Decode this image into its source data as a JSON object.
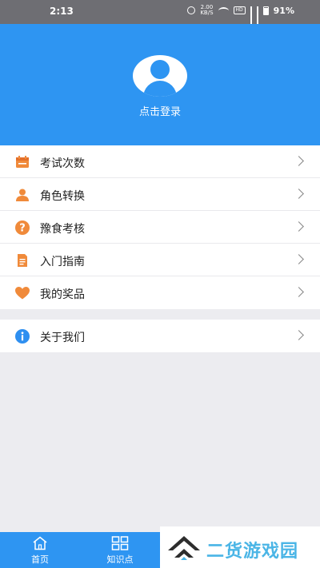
{
  "status_bar": {
    "time": "2:13",
    "net_speed": "2.00",
    "net_unit": "KB/S",
    "hd_badge": "HD",
    "battery_percent": "91%"
  },
  "header": {
    "login_text": "点击登录",
    "accent_color": "#2e95f2"
  },
  "menu": {
    "items": [
      {
        "label": "考试次数",
        "icon": "calendar-icon"
      },
      {
        "label": "角色转换",
        "icon": "user-icon"
      },
      {
        "label": "豫食考核",
        "icon": "question-circle-icon"
      },
      {
        "label": "入门指南",
        "icon": "document-icon"
      },
      {
        "label": "我的奖品",
        "icon": "heart-icon"
      }
    ],
    "about": {
      "label": "关于我们",
      "icon": "info-circle-icon"
    }
  },
  "tabbar": {
    "tabs": [
      {
        "label": "首页",
        "icon": "home-icon"
      },
      {
        "label": "知识点",
        "icon": "grid-icon"
      }
    ]
  },
  "watermark": {
    "text": "二货游戏园"
  }
}
